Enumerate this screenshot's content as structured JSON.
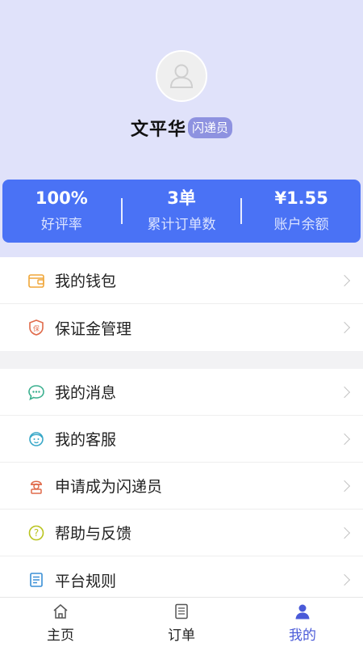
{
  "profile": {
    "name": "文平华",
    "role_badge": "闪递员"
  },
  "stats": [
    {
      "value": "100%",
      "label": "好评率"
    },
    {
      "value": "3单",
      "label": "累计订单数"
    },
    {
      "value": "¥1.55",
      "label": "账户余额"
    }
  ],
  "menu_group_1": [
    {
      "label": "我的钱包",
      "icon": "wallet-icon"
    },
    {
      "label": "保证金管理",
      "icon": "shield-deposit-icon"
    }
  ],
  "menu_group_2": [
    {
      "label": "我的消息",
      "icon": "message-icon"
    },
    {
      "label": "我的客服",
      "icon": "customer-service-icon"
    },
    {
      "label": "申请成为闪递员",
      "icon": "courier-icon"
    },
    {
      "label": "帮助与反馈",
      "icon": "help-icon"
    },
    {
      "label": "平台规则",
      "icon": "rules-icon"
    }
  ],
  "tabbar": [
    {
      "label": "主页",
      "icon": "home-icon"
    },
    {
      "label": "订单",
      "icon": "order-icon"
    },
    {
      "label": "我的",
      "icon": "user-icon",
      "active": true
    }
  ],
  "colors": {
    "header_bg": "#e0e2fa",
    "stats_card": "#4a72f5",
    "badge": "#8e92e0",
    "active_tab": "#4a5ad8"
  }
}
